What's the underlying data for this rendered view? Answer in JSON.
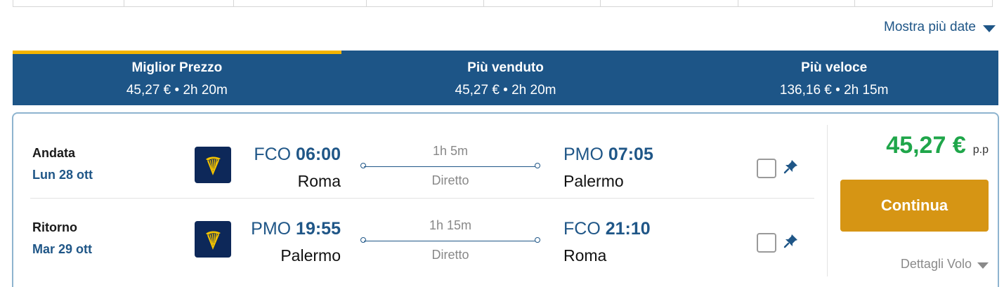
{
  "header": {
    "more_dates_label": "Mostra più date"
  },
  "sort_tabs": [
    {
      "title": "Miglior Prezzo",
      "subtitle": "45,27 € • 2h 20m",
      "active": true
    },
    {
      "title": "Più venduto",
      "subtitle": "45,27 € • 2h 20m",
      "active": false
    },
    {
      "title": "Più veloce",
      "subtitle": "136,16 € • 2h 15m",
      "active": false
    }
  ],
  "result": {
    "legs": [
      {
        "direction": "Andata",
        "date": "Lun 28 ott",
        "airline_icon": "ryanair-harp-logo",
        "departure": {
          "code": "FCO",
          "time": "06:00",
          "city": "Roma"
        },
        "duration": "1h 5m",
        "stops": "Diretto",
        "arrival": {
          "code": "PMO",
          "time": "07:05",
          "city": "Palermo"
        }
      },
      {
        "direction": "Ritorno",
        "date": "Mar 29 ott",
        "airline_icon": "ryanair-harp-logo",
        "departure": {
          "code": "PMO",
          "time": "19:55",
          "city": "Palermo"
        },
        "duration": "1h 15m",
        "stops": "Diretto",
        "arrival": {
          "code": "FCO",
          "time": "21:10",
          "city": "Roma"
        }
      }
    ],
    "price": "45,27 €",
    "price_suffix": "p.p",
    "continue_label": "Continua",
    "details_label": "Dettagli Volo"
  },
  "colors": {
    "primary_blue": "#1d5587",
    "active_tab_accent": "#f4b400",
    "price_green": "#1fa64a",
    "button_orange": "#d69514",
    "card_border": "#8eb4cf"
  }
}
